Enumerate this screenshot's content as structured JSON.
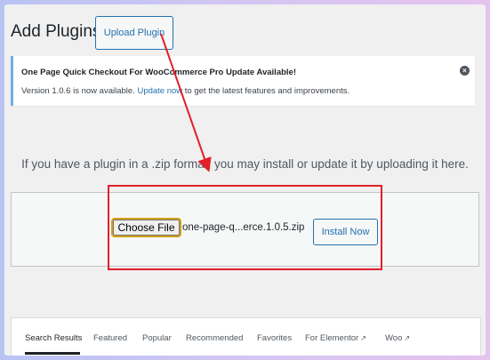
{
  "header": {
    "title": "Add Plugins",
    "upload_label": "Upload Plugin"
  },
  "notice": {
    "title": "One Page Quick Checkout For WooCommerce Pro Update Available!",
    "body_before": "Version 1.0.6 is now available. ",
    "link": "Update now",
    "body_after": " to get the latest features and improvements.",
    "dismiss_icon": "dismiss-icon"
  },
  "upload": {
    "info": "If you have a plugin in a .zip format, you may install or update it by uploading it here.",
    "choose_label": "Choose File",
    "file_name": "one-page-q...erce.1.0.5.zip",
    "install_label": "Install Now"
  },
  "annotation": {
    "color": "#e0202a"
  },
  "tabs": [
    {
      "label": "Search Results",
      "external": false
    },
    {
      "label": "Featured",
      "external": false
    },
    {
      "label": "Popular",
      "external": false
    },
    {
      "label": "Recommended",
      "external": false
    },
    {
      "label": "Favorites",
      "external": false
    },
    {
      "label": "For Elementor",
      "external": true
    },
    {
      "label": "Woo",
      "external": true
    }
  ]
}
